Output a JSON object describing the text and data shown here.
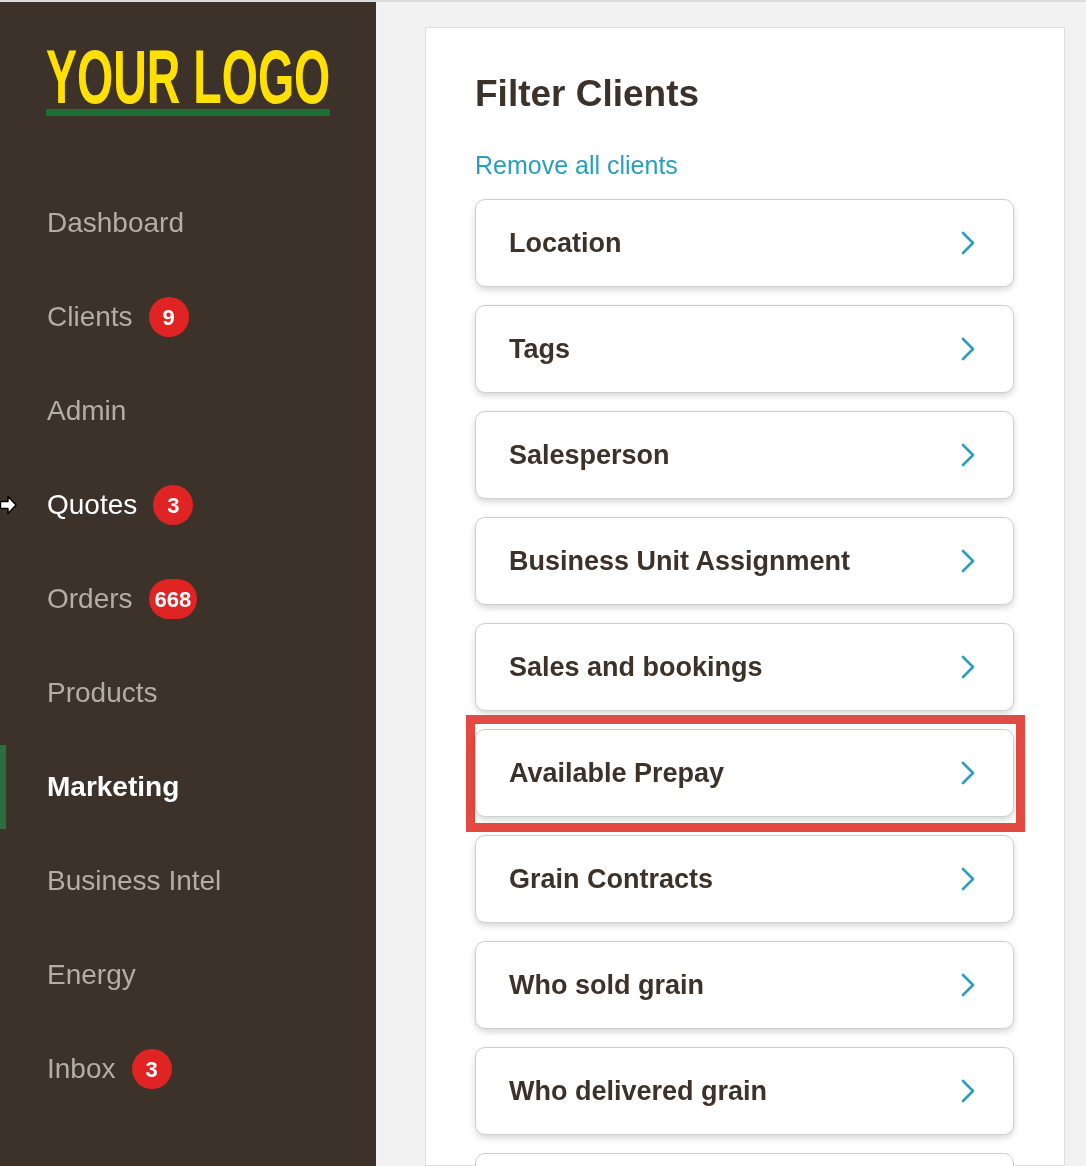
{
  "sidebar": {
    "logo": {
      "text": "YOUR LOGO"
    },
    "items": [
      {
        "label": "Dashboard",
        "selected": false,
        "hovered": false
      },
      {
        "label": "Clients",
        "badge": "9",
        "selected": false,
        "hovered": false
      },
      {
        "label": "Admin",
        "selected": false,
        "hovered": false
      },
      {
        "label": "Quotes",
        "badge": "3",
        "selected": false,
        "hovered": true
      },
      {
        "label": "Orders",
        "badge": "668",
        "selected": false,
        "hovered": false
      },
      {
        "label": "Products",
        "selected": false,
        "hovered": false
      },
      {
        "label": "Marketing",
        "selected": true,
        "hovered": false
      },
      {
        "label": "Business Intel",
        "selected": false,
        "hovered": false
      },
      {
        "label": "Energy",
        "selected": false,
        "hovered": false
      },
      {
        "label": "Inbox",
        "badge": "3",
        "selected": false,
        "hovered": false
      }
    ]
  },
  "panel": {
    "title": "Filter Clients",
    "link": "Remove all clients",
    "filters": [
      {
        "label": "Location",
        "highlighted": false
      },
      {
        "label": "Tags",
        "highlighted": false
      },
      {
        "label": "Salesperson",
        "highlighted": false
      },
      {
        "label": "Business Unit Assignment",
        "highlighted": false
      },
      {
        "label": "Sales and bookings",
        "highlighted": false
      },
      {
        "label": "Available Prepay",
        "highlighted": true
      },
      {
        "label": "Grain Contracts",
        "highlighted": false
      },
      {
        "label": "Who sold grain",
        "highlighted": false
      },
      {
        "label": "Who delivered grain",
        "highlighted": false
      }
    ],
    "has_more": true
  }
}
